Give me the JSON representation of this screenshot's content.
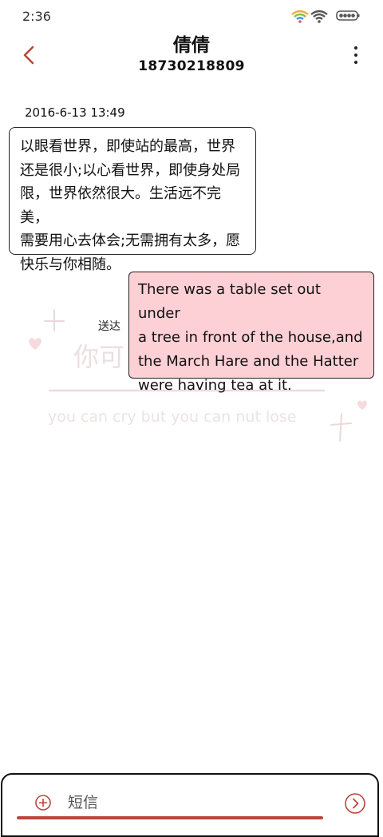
{
  "status_bar": {
    "time": "2:36",
    "icons": [
      "wifi-icon",
      "signal-icon",
      "battery-icon"
    ]
  },
  "header": {
    "contact_name": "倩倩",
    "phone_number": "18730218809",
    "back_icon": "chevron-left-icon",
    "menu_icon": "more-vertical-icon"
  },
  "conversation": {
    "timestamp": "2016-6-13 13:49",
    "incoming": {
      "lines": [
        "以眼看世界，即使站的最高，世界",
        "还是很小;以心看世界，即使身处局",
        "限，世界依然很大。生活远不完美，",
        "需要用心去体会;无需拥有太多，愿",
        "快乐与你相随。"
      ]
    },
    "outgoing": {
      "lines": [
        "There was a table set out under",
        "a tree in front of the house,and",
        "the March Hare and the Hatter",
        "were having tea at it."
      ],
      "status": "送达"
    }
  },
  "composer": {
    "placeholder": "短信",
    "add_icon": "plus-circle-icon",
    "send_icon": "send-arrow-icon"
  },
  "colors": {
    "accent": "#b9473b",
    "outgoing_bubble": "#fdd0d5",
    "watermark": "#e8d4d6"
  }
}
